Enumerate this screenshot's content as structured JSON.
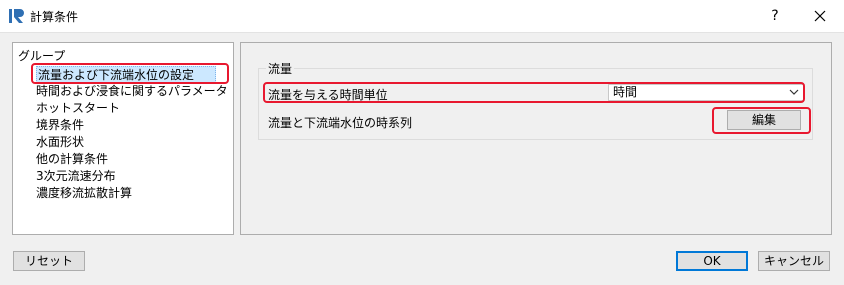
{
  "window": {
    "title": "計算条件",
    "help_label": "?"
  },
  "groups": {
    "title": "グループ",
    "items": [
      {
        "label": "流量および下流端水位の設定"
      },
      {
        "label": "時間および浸食に関するパラメータ"
      },
      {
        "label": "ホットスタート"
      },
      {
        "label": "境界条件"
      },
      {
        "label": "水面形状"
      },
      {
        "label": "他の計算条件"
      },
      {
        "label": "3次元流速分布"
      },
      {
        "label": "濃度移流拡散計算"
      }
    ]
  },
  "flow": {
    "section_title": "流量",
    "time_unit_label": "流量を与える時間単位",
    "time_unit_value": "時間",
    "timeseries_label": "流量と下流端水位の時系列",
    "edit_label": "編集"
  },
  "footer": {
    "reset_label": "リセット",
    "ok_label": "OK",
    "cancel_label": "キャンセル"
  },
  "colors": {
    "highlight": "#e8182f",
    "selection": "#cce8ff",
    "accent": "#0078d7"
  }
}
